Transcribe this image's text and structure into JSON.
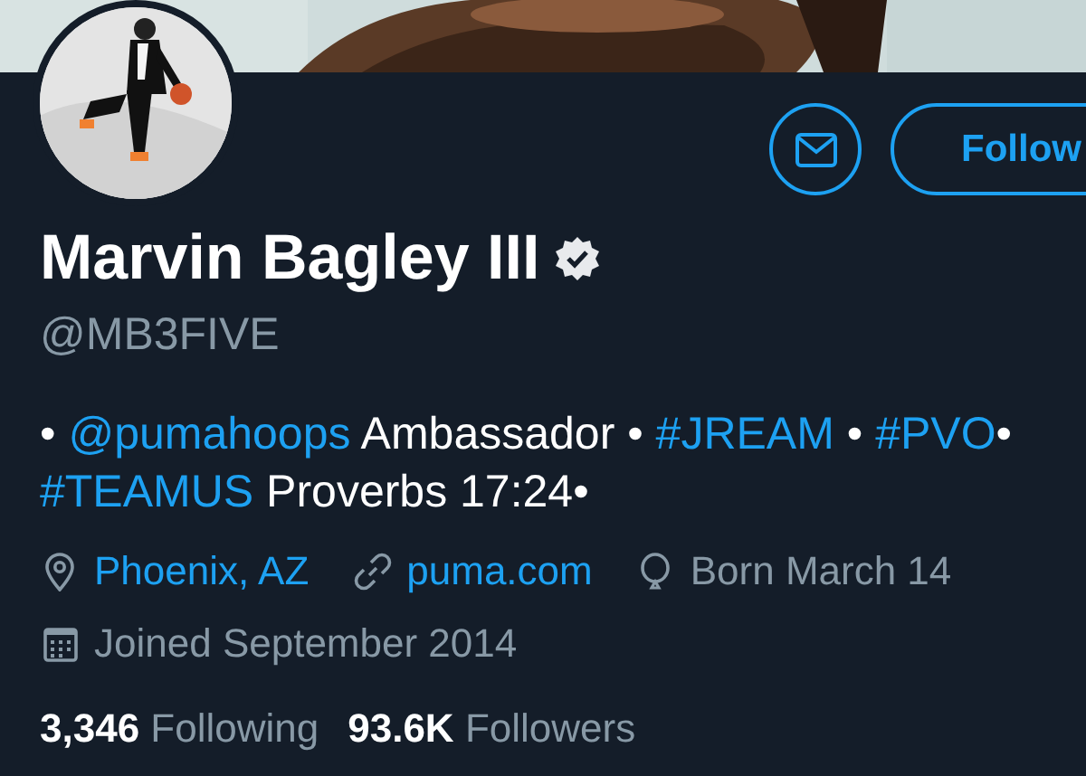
{
  "actions": [
    {
      "kind": "message"
    },
    {
      "kind": "follow",
      "label": "Follow"
    }
  ],
  "profile": {
    "name": "Marvin Bagley III",
    "verified": true,
    "handle": "@MB3FIVE"
  },
  "bio": [
    {
      "kind": "text",
      "text": "• "
    },
    {
      "kind": "mention",
      "text": "@pumahoops"
    },
    {
      "kind": "text",
      "text": " Ambassador • "
    },
    {
      "kind": "hashtag",
      "text": "#JREAM"
    },
    {
      "kind": "text",
      "text": " • "
    },
    {
      "kind": "hashtag",
      "text": "#PVO"
    },
    {
      "kind": "text",
      "text": "• "
    },
    {
      "kind": "hashtag",
      "text": "#TEAMUS"
    },
    {
      "kind": "text",
      "text": " Proverbs 17:24•"
    }
  ],
  "details": [
    {
      "kind": "location",
      "text": "Phoenix, AZ",
      "link": true
    },
    {
      "kind": "website",
      "text": "puma.com",
      "link": true
    },
    {
      "kind": "birthday",
      "text": "Born March 14",
      "link": false
    }
  ],
  "joined": {
    "kind": "joined",
    "text": "Joined September 2014"
  },
  "stats": [
    {
      "count": "3,346",
      "label": "Following"
    },
    {
      "count": "93.6K",
      "label": "Followers"
    }
  ]
}
